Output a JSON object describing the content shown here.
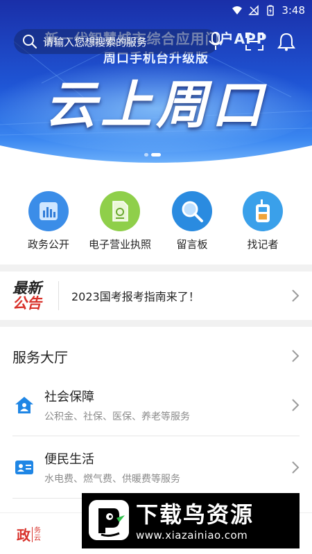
{
  "status_bar": {
    "time": "3:48"
  },
  "banner": {
    "line1": "新一代智慧城市综合应用门户APP",
    "line2": "周口手机台升级版",
    "big_title": "云上周口",
    "page_count": 2,
    "active_page": 1
  },
  "search": {
    "placeholder": "请输入您想搜索的服务"
  },
  "quick_entries": [
    {
      "label": "政务公开",
      "icon": "bar-chart-icon",
      "color": "#3b8de8"
    },
    {
      "label": "电子营业执照",
      "icon": "license-icon",
      "color": "#8fcf4a"
    },
    {
      "label": "留言板",
      "icon": "magnifier-icon",
      "color": "#2a8be0"
    },
    {
      "label": "找记者",
      "icon": "walkie-talkie-icon",
      "color": "#3aa0ea"
    }
  ],
  "notice": {
    "badge_top": "最新",
    "badge_bottom": "公告",
    "text": "2023国考报考指南来了！"
  },
  "service_hall": {
    "title": "服务大厅",
    "items": [
      {
        "title": "社会保障",
        "subtitle": "公积金、社保、医保、养老等服务",
        "icon": "house-person-icon"
      },
      {
        "title": "便民生活",
        "subtitle": "水电费、燃气费、供暖费等服务",
        "icon": "id-card-icon"
      }
    ]
  },
  "bottom_partial": {
    "logo_main": "政",
    "logo_sub_1": "务",
    "logo_sub_2": "云"
  },
  "watermark": {
    "title": "下载鸟资源",
    "url": "www.xiazainiao.com"
  },
  "colors": {
    "accent": "#1f86e5",
    "notice_red": "#d8322b",
    "banner_blue": "#1c3fc4"
  }
}
